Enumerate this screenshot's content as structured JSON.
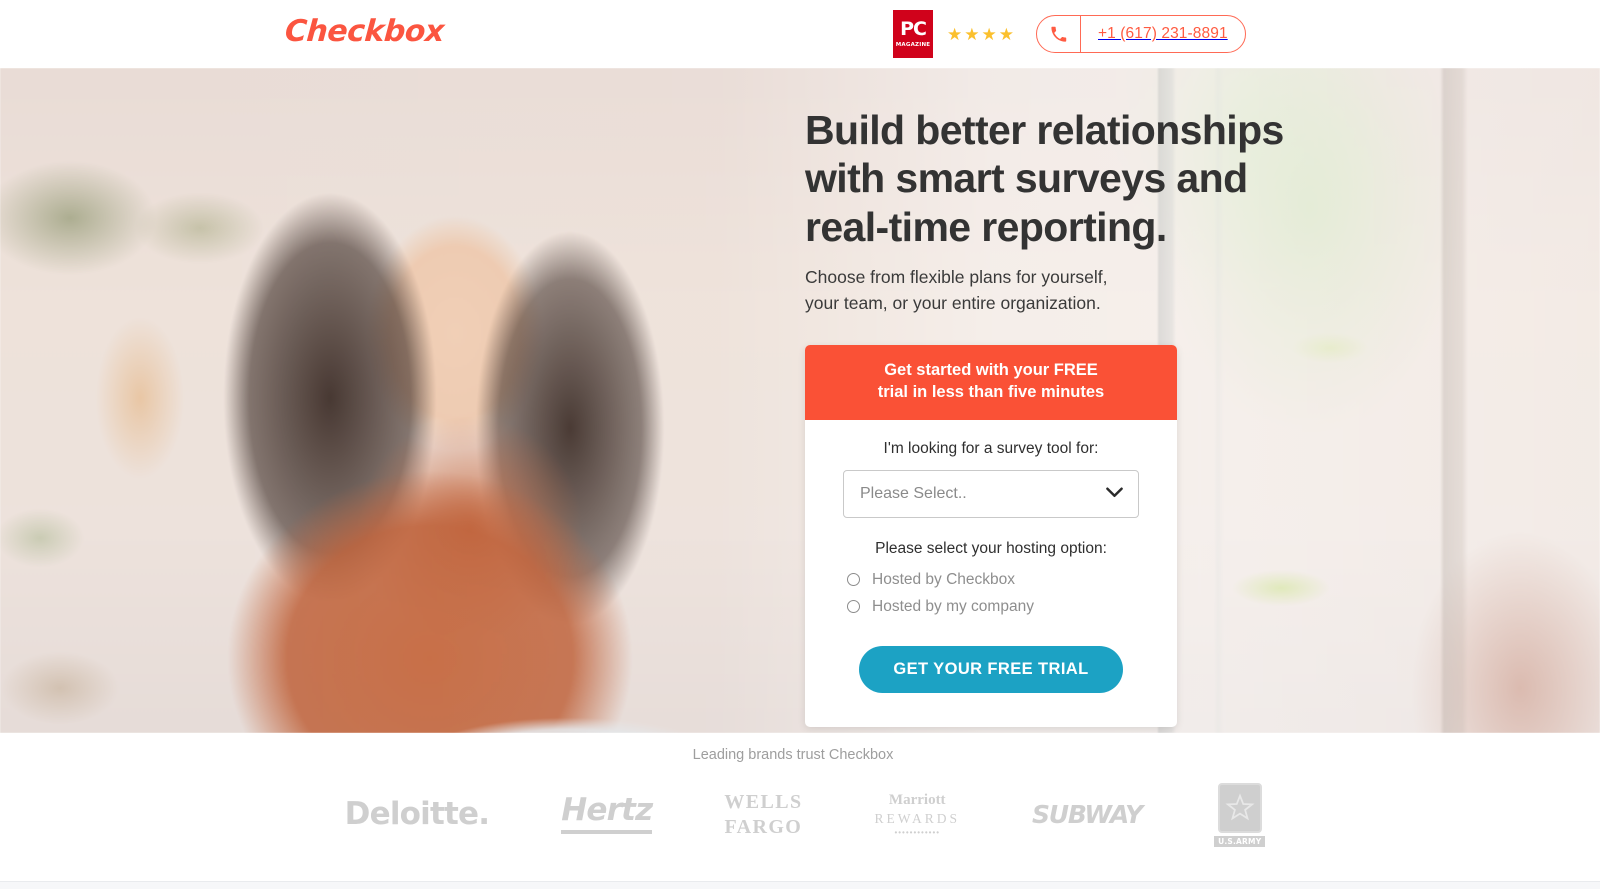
{
  "header": {
    "logo_text": "Checkbox",
    "pc_badge": {
      "top": "PC",
      "bottom": "MAGAZINE",
      "icon": "pc-magazine-badge"
    },
    "stars": {
      "icon": "star-icon",
      "count": 4,
      "glyph": "★",
      "color": "#FBC02D"
    },
    "phone": {
      "icon": "phone-icon",
      "number": "+1 (617) 231-8891"
    }
  },
  "hero": {
    "title": "Build better relationships\nwith smart surveys and\nreal-time reporting.",
    "subtitle": "Choose from flexible plans for yourself,\nyour team, or your entire organization."
  },
  "form": {
    "banner": "Get started with your FREE\ntrial in less than five minutes",
    "survey_tool_label": "I'm looking for a survey tool for:",
    "select_value": "Please Select..",
    "select_placeholder": "Please Select..",
    "chevron_icon": "chevron-down-icon",
    "hosting_label": "Please select your hosting option:",
    "hosting_options": [
      {
        "label": "Hosted by Checkbox",
        "selected": false
      },
      {
        "label": "Hosted by my company",
        "selected": false
      }
    ],
    "cta_label": "GET YOUR FREE TRIAL"
  },
  "brands": {
    "caption": "Leading brands trust Checkbox",
    "logos": [
      {
        "name": "deloitte",
        "text": "Deloitte."
      },
      {
        "name": "hertz",
        "text": "Hertz"
      },
      {
        "name": "wells-fargo",
        "text": "WELLS\nFARGO"
      },
      {
        "name": "marriott-rewards",
        "top": "Marriott",
        "bottom": "REWARDS",
        "dots": "••••••••••••"
      },
      {
        "name": "subway",
        "text": "SUBWAY"
      },
      {
        "name": "us-army",
        "text": "U.S.ARMY",
        "icon": "star-icon"
      }
    ]
  },
  "colors": {
    "brand_orange": "#FB5540",
    "banner_orange": "#FA5136",
    "cta_teal": "#1CA2C4",
    "star_gold": "#FBC02D",
    "pc_red": "#D0021B",
    "brand_grey": "#CFCFCF"
  }
}
